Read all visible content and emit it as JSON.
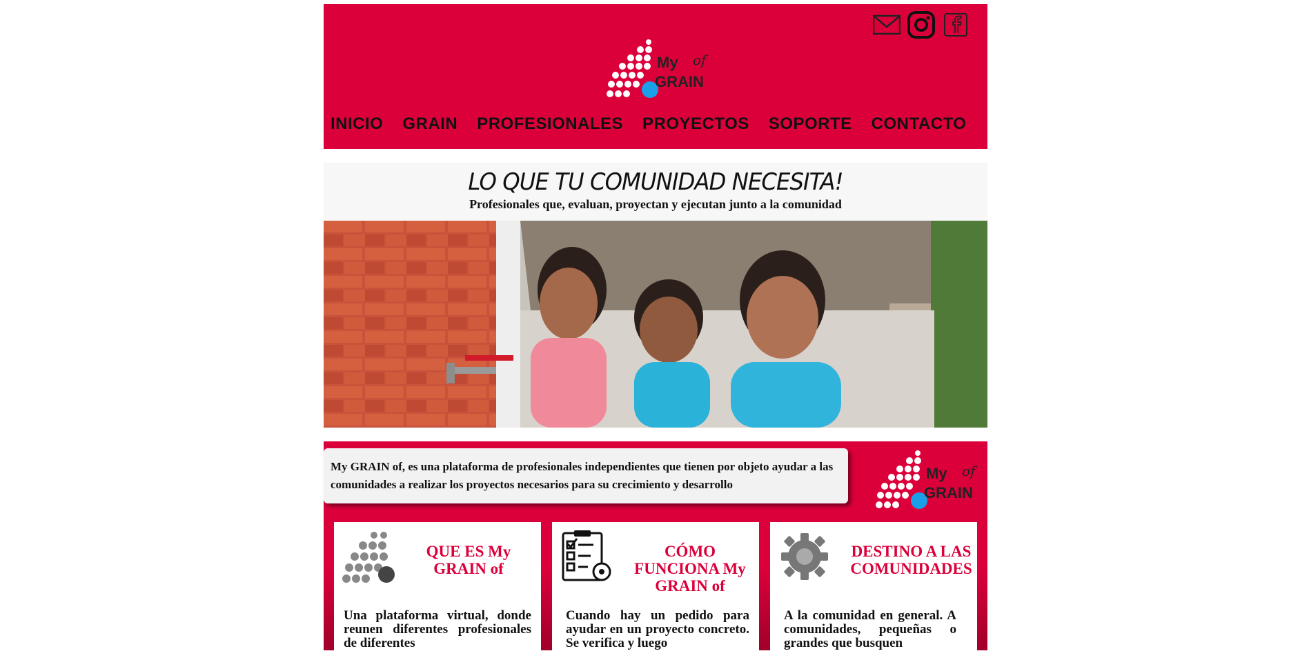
{
  "colors": {
    "brand_red": "#dc003a",
    "logo_blue": "#1aa0e8"
  },
  "header": {
    "social": [
      {
        "name": "mail-icon"
      },
      {
        "name": "instagram-icon"
      },
      {
        "name": "facebook-icon"
      }
    ],
    "logo": {
      "word1": "My",
      "word2": "GRAIN",
      "word3": "of"
    },
    "nav": [
      "INICIO",
      "GRAIN",
      "PROFESIONALES",
      "PROYECTOS",
      "SOPORTE",
      "CONTACTO"
    ]
  },
  "hero": {
    "title": "LO QUE TU COMUNIDAD NECESITA!",
    "subtitle": "Profesionales que, evaluan, proyectan y ejecutan junto a la comunidad"
  },
  "info": {
    "intro": "My GRAIN of, es una plataforma de profesionales independientes que tienen por objeto ayudar a las comunidades a realizar los proyectos necesarios para su crecimiento y desarrollo",
    "cards": [
      {
        "title": "QUE ES My GRAIN of",
        "text": "Una plataforma virtual, donde reunen diferentes profesionales de diferentes"
      },
      {
        "title": "CÓMO FUNCIONA My GRAIN of",
        "text": "Cuando hay un pedido para ayudar en un proyecto concreto. Se verifica y luego"
      },
      {
        "title": "DESTINO A LAS COMUNIDADES",
        "text": "A la comunidad en general. A comunidades, pequeñas o grandes que busquen"
      }
    ]
  }
}
